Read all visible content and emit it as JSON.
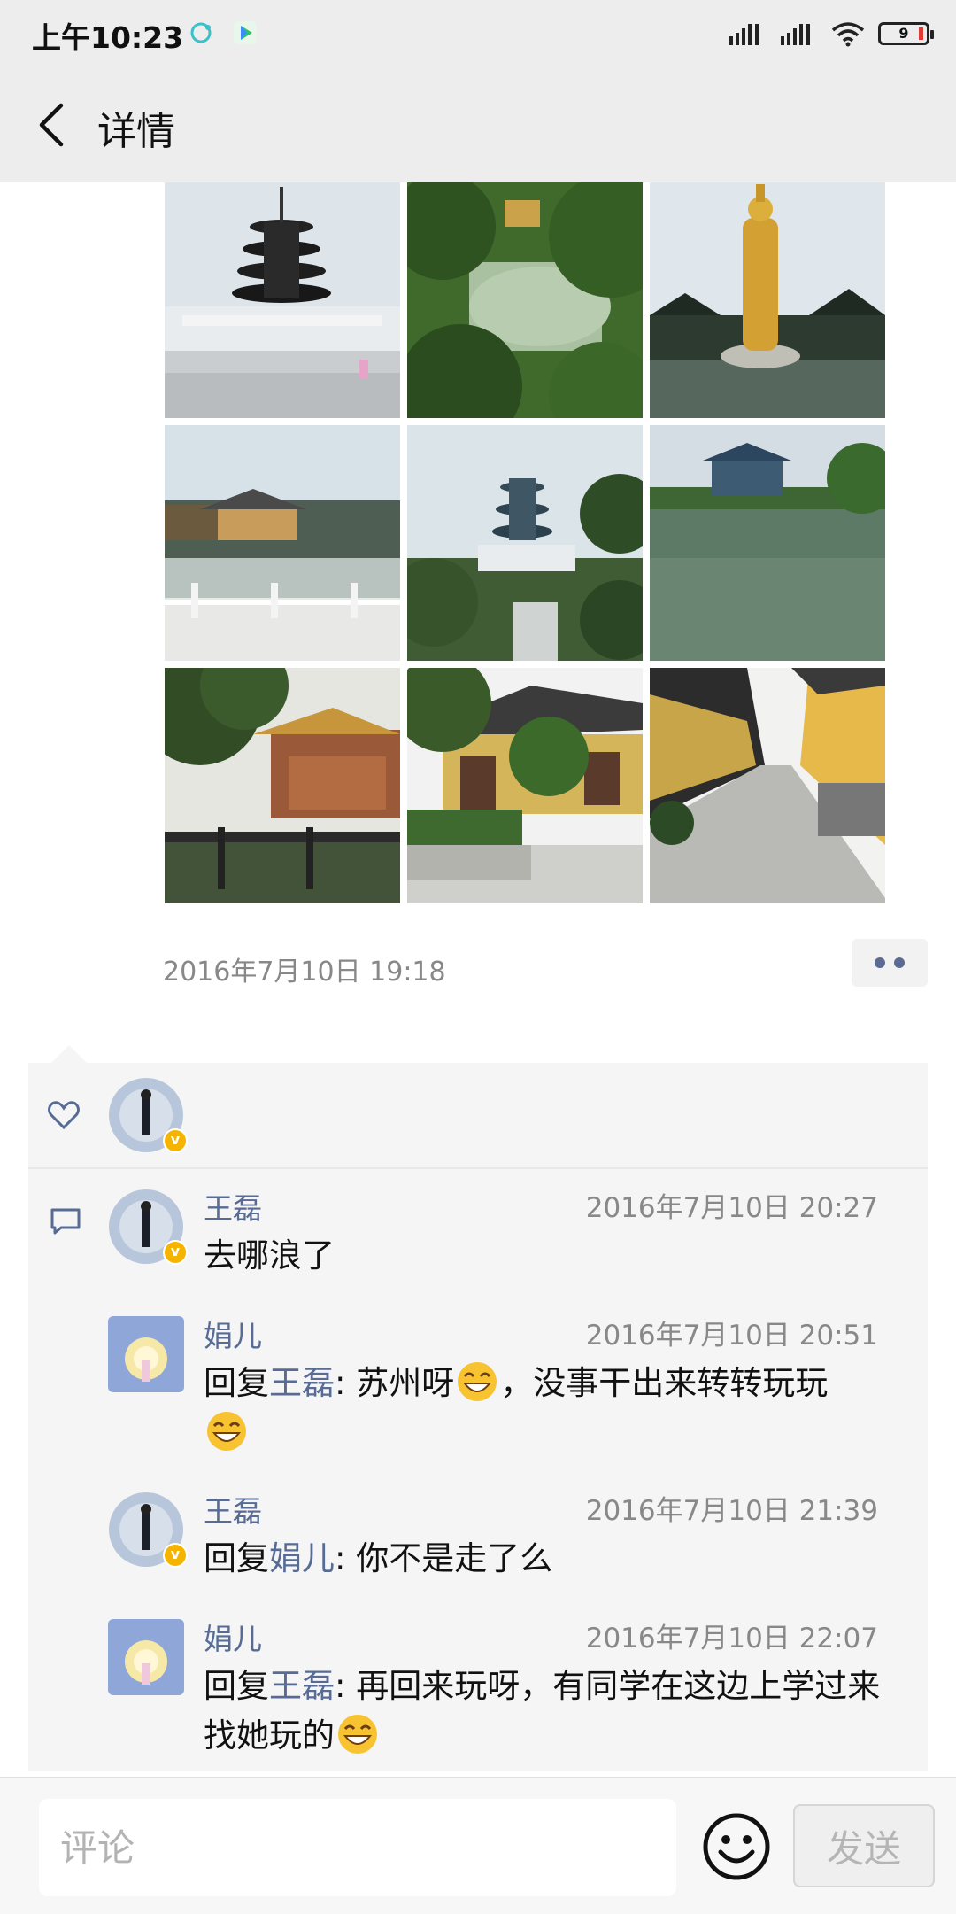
{
  "status_bar": {
    "time": "上午10:23",
    "battery": "9"
  },
  "header": {
    "title": "详情"
  },
  "photos": [
    {
      "name": "pagoda-square"
    },
    {
      "name": "lake-trees"
    },
    {
      "name": "golden-statue"
    },
    {
      "name": "temple-bridge"
    },
    {
      "name": "pagoda-hill"
    },
    {
      "name": "pond-pavilion"
    },
    {
      "name": "garden-hall"
    },
    {
      "name": "temple-path"
    },
    {
      "name": "corridor"
    }
  ],
  "post": {
    "time": "2016年7月10日 19:18"
  },
  "comments": [
    {
      "author": "王磊",
      "time": "2016年7月10日 20:27",
      "text": "去哪浪了"
    },
    {
      "author": "娟儿",
      "time": "2016年7月10日 20:51",
      "reply_prefix": "回复",
      "reply_to": "王磊",
      "text": ": 苏州呀",
      "text2": "，没事干出来转转玩玩"
    },
    {
      "author": "王磊",
      "time": "2016年7月10日 21:39",
      "reply_prefix": "回复",
      "reply_to": "娟儿",
      "text": ": 你不是走了么"
    },
    {
      "author": "娟儿",
      "time": "2016年7月10日 22:07",
      "reply_prefix": "回复",
      "reply_to": "王磊",
      "text": ": 再回来玩呀，有同学在这边上学过来找她玩的"
    }
  ],
  "input": {
    "placeholder": "评论",
    "send_label": "发送"
  }
}
